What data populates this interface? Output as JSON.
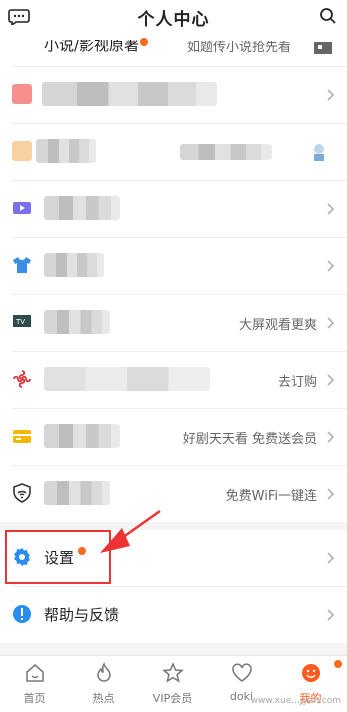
{
  "header": {
    "title": "个人中心"
  },
  "rows": {
    "top": {
      "label": "小说/影视原著",
      "right": "如题传小说抢先看"
    },
    "tv": {
      "right": "大屏观看更爽"
    },
    "unicom": {
      "right": "去订购"
    },
    "card": {
      "right": "好剧天天看 免费送会员"
    },
    "wifi": {
      "right": "免费WiFi一键连"
    },
    "settings": {
      "label": "设置"
    },
    "help": {
      "label": "帮助与反馈"
    }
  },
  "tabs": [
    {
      "label": "首页"
    },
    {
      "label": "热点"
    },
    {
      "label": "VIP会员"
    },
    {
      "label": "doki"
    },
    {
      "label": "我的"
    }
  ],
  "watermark": "www.xue...jyan.com",
  "colors": {
    "accent": "#ff5a1f",
    "annotation": "#ee3333",
    "settings_icon": "#2b8cf0",
    "help_icon": "#2b8cf0"
  }
}
